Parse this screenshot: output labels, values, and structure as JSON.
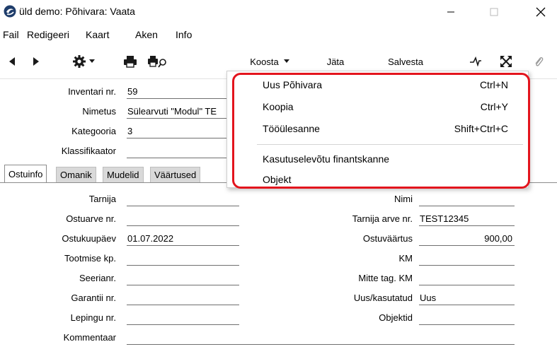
{
  "window": {
    "title": "üld demo: Põhivara: Vaata",
    "minimize_icon": "minimize-icon",
    "maximize_icon": "maximize-icon",
    "close_icon": "close-icon"
  },
  "menubar": {
    "items": [
      "Fail",
      "Redigeeri",
      "Kaart",
      "Aken",
      "Info"
    ]
  },
  "toolbar": {
    "koosta_label": "Koosta",
    "jata_label": "Jäta",
    "salvesta_label": "Salvesta"
  },
  "header": {
    "inventari_nr": {
      "label": "Inventari nr.",
      "value": "59"
    },
    "nimetus": {
      "label": "Nimetus",
      "value": "Sülearvuti \"Modul\" TE"
    },
    "kategooria": {
      "label": "Kategooria",
      "value": "3"
    },
    "klassifikaator": {
      "label": "Klassifikaator",
      "value": ""
    }
  },
  "tabs": [
    "Ostuinfo",
    "Omanik",
    "Mudelid",
    "Väärtused"
  ],
  "ostuinfo": {
    "left": [
      {
        "label": "Tarnija",
        "value": ""
      },
      {
        "label": "Ostuarve nr.",
        "value": ""
      },
      {
        "label": "Ostukuupäev",
        "value": "01.07.2022"
      },
      {
        "label": "Tootmise kp.",
        "value": ""
      },
      {
        "label": "Seerianr.",
        "value": ""
      },
      {
        "label": "Garantii nr.",
        "value": ""
      },
      {
        "label": "Lepingu nr.",
        "value": ""
      }
    ],
    "right": [
      {
        "label": "Nimi",
        "value": ""
      },
      {
        "label": "Tarnija arve nr.",
        "value": "TEST12345"
      },
      {
        "label": "Ostuväärtus",
        "value": "900,00"
      },
      {
        "label": "KM",
        "value": ""
      },
      {
        "label": "Mitte tag. KM",
        "value": ""
      },
      {
        "label": "Uus/kasutatud",
        "value": "Uus"
      },
      {
        "label": "Objektid",
        "value": ""
      }
    ],
    "kommentaar": {
      "label": "Kommentaar",
      "value": ""
    }
  },
  "koosta_menu": {
    "items": [
      {
        "label": "Uus Põhivara",
        "shortcut": "Ctrl+N"
      },
      {
        "label": "Koopia",
        "shortcut": "Ctrl+Y"
      },
      {
        "label": "Tööülesanne",
        "shortcut": "Shift+Ctrl+C"
      },
      {
        "label": "Kasutuselevõtu finantskanne",
        "shortcut": ""
      },
      {
        "label": "Objekt",
        "shortcut": ""
      }
    ]
  },
  "colors": {
    "highlight_outline": "#e3141d",
    "tab_inactive": "#d9d9d9"
  }
}
